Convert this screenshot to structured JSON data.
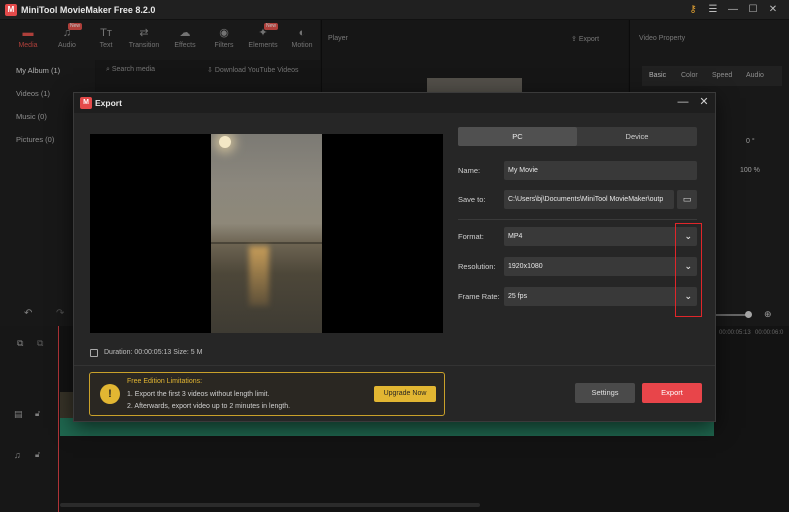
{
  "app": {
    "title": "MiniTool MovieMaker Free 8.2.0",
    "logo": "M"
  },
  "tools": [
    {
      "label": "Media",
      "icon": "folder-icon",
      "glyph": "▬",
      "badge": ""
    },
    {
      "label": "Audio",
      "icon": "music-note-icon",
      "glyph": "♫",
      "badge": "New"
    },
    {
      "label": "Text",
      "icon": "text-icon",
      "glyph": "Tт",
      "badge": ""
    },
    {
      "label": "Transition",
      "icon": "swap-icon",
      "glyph": "⇄",
      "badge": ""
    },
    {
      "label": "Effects",
      "icon": "effects-icon",
      "glyph": "☁",
      "badge": ""
    },
    {
      "label": "Filters",
      "icon": "filters-icon",
      "glyph": "◉",
      "badge": ""
    },
    {
      "label": "Elements",
      "icon": "elements-icon",
      "glyph": "✦",
      "badge": "New"
    },
    {
      "label": "Motion",
      "icon": "motion-icon",
      "glyph": "◐",
      "badge": ""
    }
  ],
  "sidebar": [
    "My Album (1)",
    "Videos (1)",
    "Music (0)",
    "Pictures (0)"
  ],
  "media": {
    "search": "Search media",
    "download": "Download YouTube Videos"
  },
  "player": {
    "label": "Player",
    "export": "Export"
  },
  "property": {
    "label": "Video Property",
    "tabs": [
      "Basic",
      "Color",
      "Speed",
      "Audio"
    ],
    "rotation": "0 °",
    "zoom": "100 %"
  },
  "dialog": {
    "title": "Export",
    "tabs": {
      "pc": "PC",
      "device": "Device"
    },
    "name_label": "Name:",
    "name_value": "My Movie",
    "save_label": "Save to:",
    "save_value": "C:\\Users\\bj\\Documents\\MiniTool MovieMaker\\outp",
    "format_label": "Format:",
    "format_value": "MP4",
    "resolution_label": "Resolution:",
    "resolution_value": "1920x1080",
    "framerate_label": "Frame Rate:",
    "framerate_value": "25 fps",
    "duration": "Duration:  00:00:05:13  Size: 5 M",
    "notice_title": "Free Edition Limitations:",
    "notice_line1": "1. Export the first 3 videos without length limit.",
    "notice_line2": "2. Afterwards, export video up to 2 minutes in length.",
    "upgrade": "Upgrade Now",
    "settings": "Settings",
    "export": "Export"
  },
  "timeline": {
    "time1": "00:00:05:13",
    "time2": "00:00:06:0"
  },
  "colors": {
    "accent": "#e8454a",
    "warning": "#e2b632",
    "highlight": "#e0262a"
  }
}
